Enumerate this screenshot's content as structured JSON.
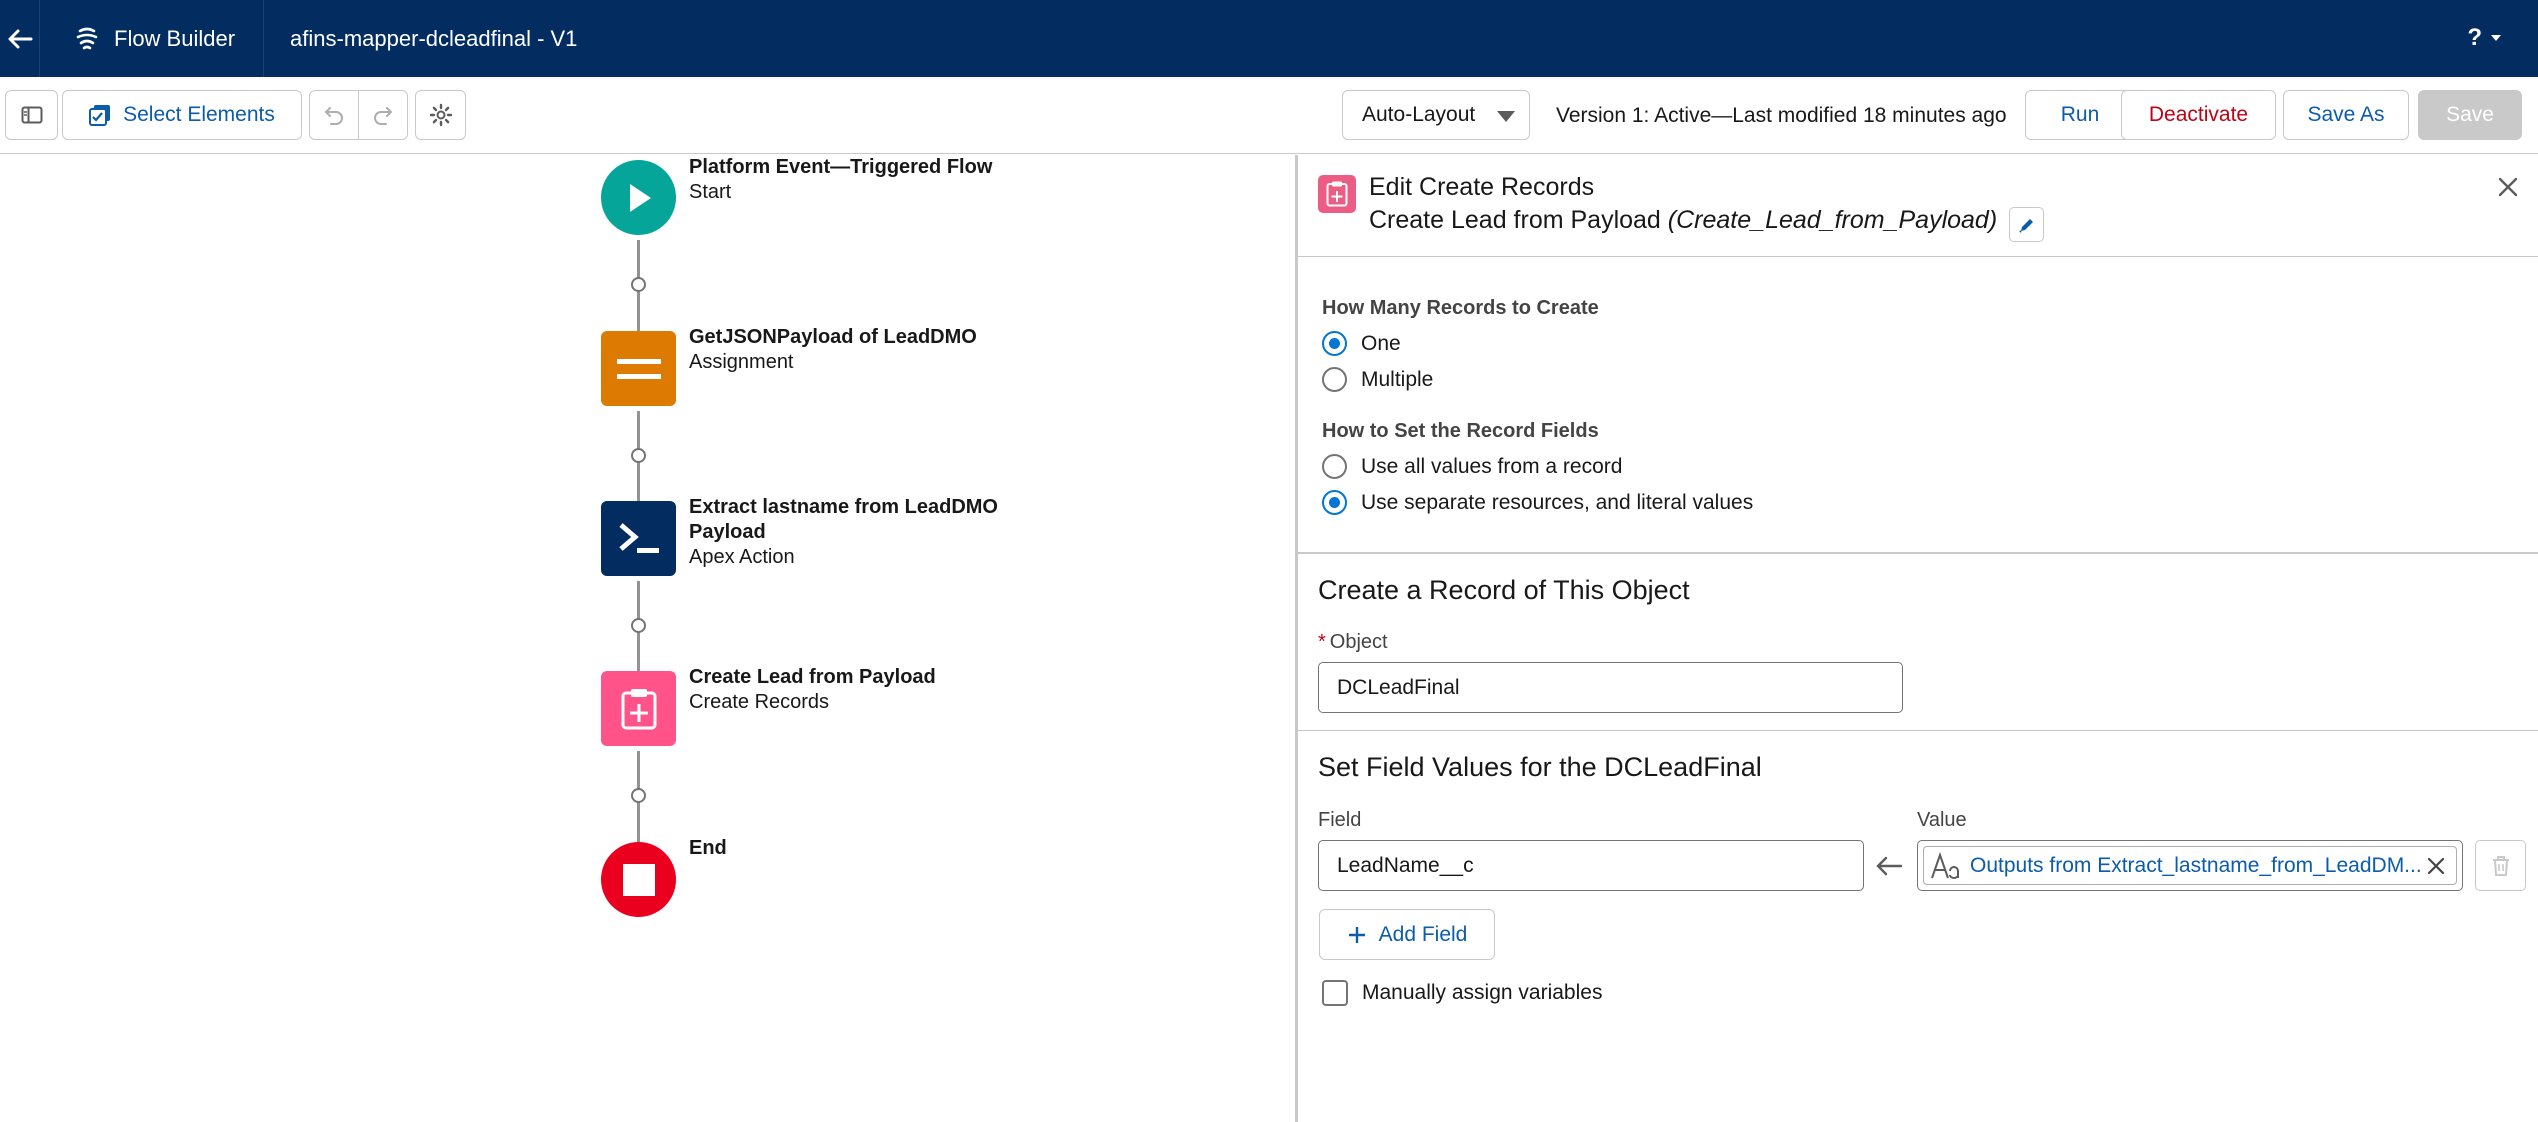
{
  "header": {
    "app_name": "Flow Builder",
    "flow_title": "afins-mapper-dcleadfinal - V1",
    "help_label": "?"
  },
  "toolbar": {
    "select_elements_label": "Select Elements",
    "layout_value": "Auto-Layout",
    "version_text": "Version 1: Active—Last modified 18 minutes ago",
    "run_label": "Run",
    "deactivate_label": "Deactivate",
    "save_as_label": "Save As",
    "save_label": "Save"
  },
  "flow": {
    "nodes": [
      {
        "title": "Platform Event—Triggered Flow",
        "subtitle": "Start",
        "icon": "play-icon",
        "color": "#06a59a"
      },
      {
        "title": "GetJSONPayload of LeadDMO",
        "subtitle": "Assignment",
        "icon": "equals-icon",
        "color": "#dd7a01"
      },
      {
        "title": "Extract lastname from LeadDMO Payload",
        "subtitle": "Apex Action",
        "icon": "terminal-icon",
        "color": "#032d60"
      },
      {
        "title": "Create Lead from Payload",
        "subtitle": "Create Records",
        "icon": "clipboard-plus-icon",
        "color": "#ff538a"
      },
      {
        "title": "End",
        "subtitle": "",
        "icon": "stop-icon",
        "color": "#ea001e"
      }
    ]
  },
  "panel": {
    "title": "Edit Create Records",
    "subtitle_label": "Create Lead from Payload",
    "subtitle_api": "(Create_Lead_from_Payload)",
    "how_many_label": "How Many Records to Create",
    "how_many_options": [
      "One",
      "Multiple"
    ],
    "how_many_selected": "One",
    "how_set_label": "How to Set the Record Fields",
    "how_set_options": [
      "Use all values from a record",
      "Use separate resources, and literal values"
    ],
    "how_set_selected": "Use separate resources, and literal values",
    "object_section_title": "Create a Record of This Object",
    "object_label": "Object",
    "object_required_mark": "*",
    "object_value": "DCLeadFinal",
    "field_values_title": "Set Field Values for the DCLeadFinal",
    "field_col_label": "Field",
    "value_col_label": "Value",
    "field_value": "LeadName__c",
    "value_text": "Outputs from Extract_lastname_from_LeadDM...",
    "add_field_label": "Add Field",
    "manual_assign_label": "Manually assign variables"
  },
  "colors": {
    "header_bg": "#032d60",
    "brand_blue": "#0b5cab",
    "danger": "#ba0517"
  }
}
